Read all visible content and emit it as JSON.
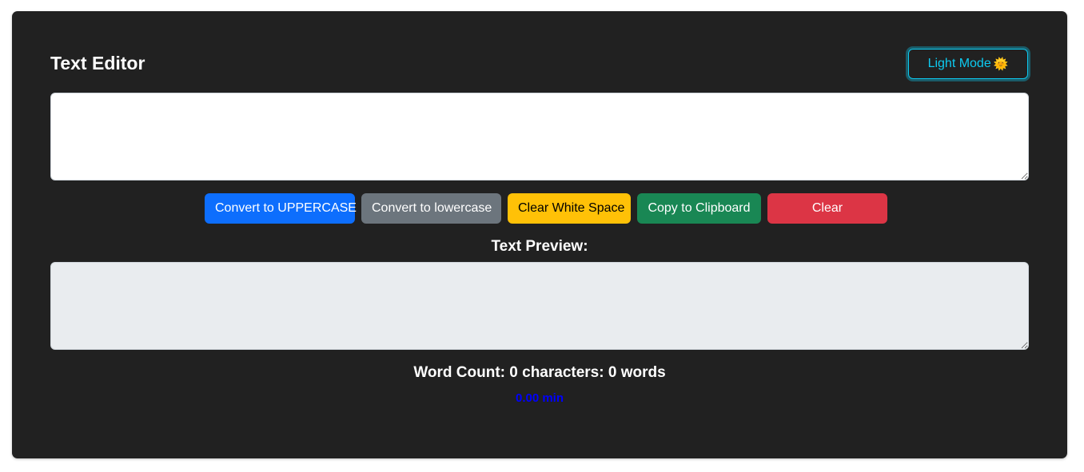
{
  "header": {
    "title": "Text Editor",
    "mode_toggle_label": "Light Mode",
    "mode_toggle_icon": "sun-icon"
  },
  "editor": {
    "value": "",
    "placeholder": ""
  },
  "actions": {
    "uppercase_label": "Convert to UPPERCASE",
    "lowercase_label": "Convert to lowercase",
    "clear_space_label": "Clear White Space",
    "copy_label": "Copy to Clipboard",
    "clear_label": "Clear"
  },
  "preview": {
    "heading": "Text Preview:",
    "value": ""
  },
  "stats": {
    "word_count": "Word Count: 0 characters: 0 words",
    "read_time": "0.00 min"
  },
  "colors": {
    "background": "#212121",
    "accent": "#0dcaf0",
    "primary": "#0d6efd",
    "secondary": "#6c757d",
    "warning": "#ffc107",
    "success": "#198754",
    "danger": "#dc3545",
    "read_time": "#0000ff"
  }
}
